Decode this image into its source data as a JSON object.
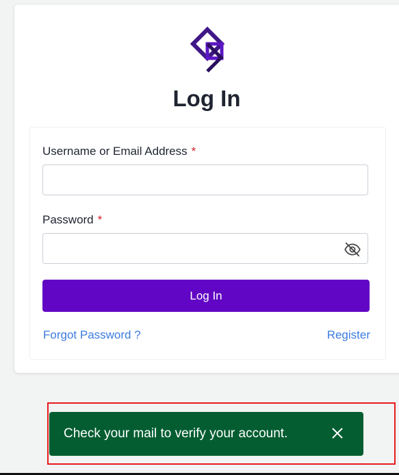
{
  "icons": {
    "logo": "brand-logo",
    "password_toggle": "eye-off-icon",
    "close": "close-icon"
  },
  "colors": {
    "primary": "#6106c4",
    "link": "#3c7be0",
    "required": "#d6202c",
    "toast_bg": "#035d31",
    "highlight": "#e8191c"
  },
  "login": {
    "title": "Log In",
    "username_label": "Username or Email Address",
    "username_value": "",
    "password_label": "Password",
    "password_value": "",
    "required_mark": "*",
    "submit_label": "Log In",
    "forgot_label": "Forgot Password ?",
    "register_label": "Register"
  },
  "toast": {
    "message": "Check your mail to verify your account."
  }
}
